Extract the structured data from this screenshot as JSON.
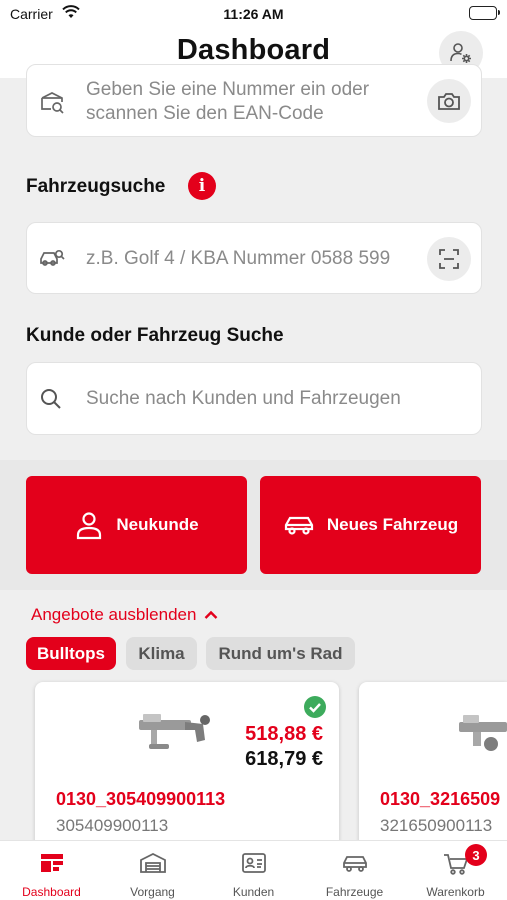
{
  "status_bar": {
    "carrier": "Carrier",
    "time": "11:26 AM"
  },
  "nav": {
    "title": "Dashboard"
  },
  "ean_search": {
    "placeholder": "Geben Sie eine Nummer ein oder scannen Sie den EAN-Code"
  },
  "vehicle_search": {
    "label": "Fahrzeugsuche",
    "info": "i",
    "placeholder": "z.B. Golf 4 / KBA Nummer 0588 599"
  },
  "customer_search": {
    "label": "Kunde oder Fahrzeug Suche",
    "placeholder": "Suche nach Kunden und Fahrzeugen"
  },
  "actions": {
    "new_customer": "Neukunde",
    "new_vehicle": "Neues Fahrzeug"
  },
  "offers": {
    "toggle_label": "Angebote ausblenden",
    "categories": [
      {
        "label": "Bulltops",
        "selected": true
      },
      {
        "label": "Klima",
        "selected": false
      },
      {
        "label": "Rund um's Rad",
        "selected": false
      }
    ],
    "products": [
      {
        "name": "0130_305409900113",
        "ean": "305409900113",
        "price_offer": "518,88 €",
        "price_regular": "618,79 €",
        "available": true
      },
      {
        "name": "0130_3216509",
        "ean": "321650900113"
      }
    ]
  },
  "tabbar": {
    "items": [
      {
        "label": "Dashboard",
        "icon": "dashboard-icon",
        "active": true
      },
      {
        "label": "Vorgang",
        "icon": "warehouse-icon",
        "active": false
      },
      {
        "label": "Kunden",
        "icon": "contact-card-icon",
        "active": false
      },
      {
        "label": "Fahrzeuge",
        "icon": "car-icon",
        "active": false
      },
      {
        "label": "Warenkorb",
        "icon": "cart-icon",
        "active": false,
        "badge": "3"
      }
    ]
  },
  "colors": {
    "accent": "#e3001b",
    "background": "#efefef",
    "surface": "#ffffff",
    "muted": "#8a8a8a"
  }
}
